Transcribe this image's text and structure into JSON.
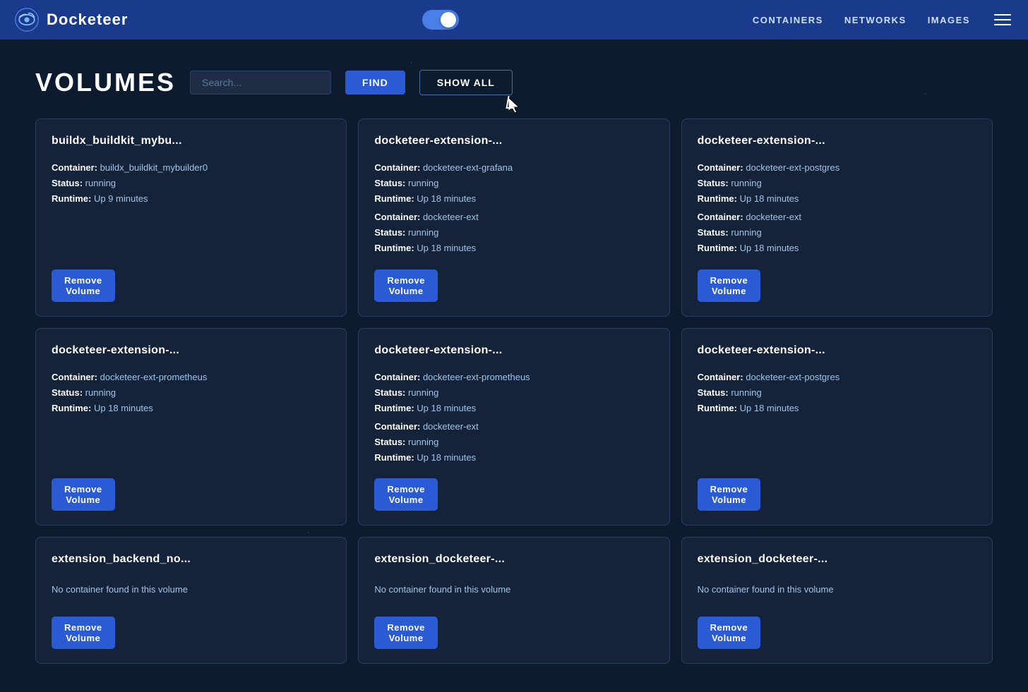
{
  "app": {
    "brand": "Docketeer",
    "nav": {
      "containers": "CONTAINERS",
      "networks": "NETWORKS",
      "images": "IMAGES"
    }
  },
  "page": {
    "title": "VOLUMES",
    "search_placeholder": "Search...",
    "find_label": "FIND",
    "show_all_label": "SHOW ALL"
  },
  "volumes": [
    {
      "id": "v1",
      "name": "buildx_buildkit_mybu...",
      "containers": [
        {
          "container": "buildx_buildkit_mybuilder0",
          "status": "running",
          "runtime": "Up 9 minutes"
        }
      ],
      "empty": false
    },
    {
      "id": "v2",
      "name": "docketeer-extension-...",
      "containers": [
        {
          "container": "docketeer-ext-grafana",
          "status": "running",
          "runtime": "Up 18 minutes"
        },
        {
          "container": "docketeer-ext",
          "status": "running",
          "runtime": "Up 18 minutes"
        }
      ],
      "empty": false
    },
    {
      "id": "v3",
      "name": "docketeer-extension-...",
      "containers": [
        {
          "container": "docketeer-ext-postgres",
          "status": "running",
          "runtime": "Up 18 minutes"
        },
        {
          "container": "docketeer-ext",
          "status": "running",
          "runtime": "Up 18 minutes"
        }
      ],
      "empty": false
    },
    {
      "id": "v4",
      "name": "docketeer-extension-...",
      "containers": [
        {
          "container": "docketeer-ext-prometheus",
          "status": "running",
          "runtime": "Up 18 minutes"
        }
      ],
      "empty": false
    },
    {
      "id": "v5",
      "name": "docketeer-extension-...",
      "containers": [
        {
          "container": "docketeer-ext-prometheus",
          "status": "running",
          "runtime": "Up 18 minutes"
        },
        {
          "container": "docketeer-ext",
          "status": "running",
          "runtime": "Up 18 minutes"
        }
      ],
      "empty": false
    },
    {
      "id": "v6",
      "name": "docketeer-extension-...",
      "containers": [
        {
          "container": "docketeer-ext-postgres",
          "status": "running",
          "runtime": "Up 18 minutes"
        }
      ],
      "empty": false
    },
    {
      "id": "v7",
      "name": "extension_backend_no...",
      "containers": [],
      "empty": true,
      "empty_msg": "No container found in this volume"
    },
    {
      "id": "v8",
      "name": "extension_docketeer-...",
      "containers": [],
      "empty": true,
      "empty_msg": "No container found in this volume"
    },
    {
      "id": "v9",
      "name": "extension_docketeer-...",
      "containers": [],
      "empty": true,
      "empty_msg": "No container found in this volume"
    }
  ],
  "labels": {
    "container": "Container:",
    "status": "Status:",
    "runtime": "Runtime:",
    "remove_volume": "Remove\nVolume"
  }
}
